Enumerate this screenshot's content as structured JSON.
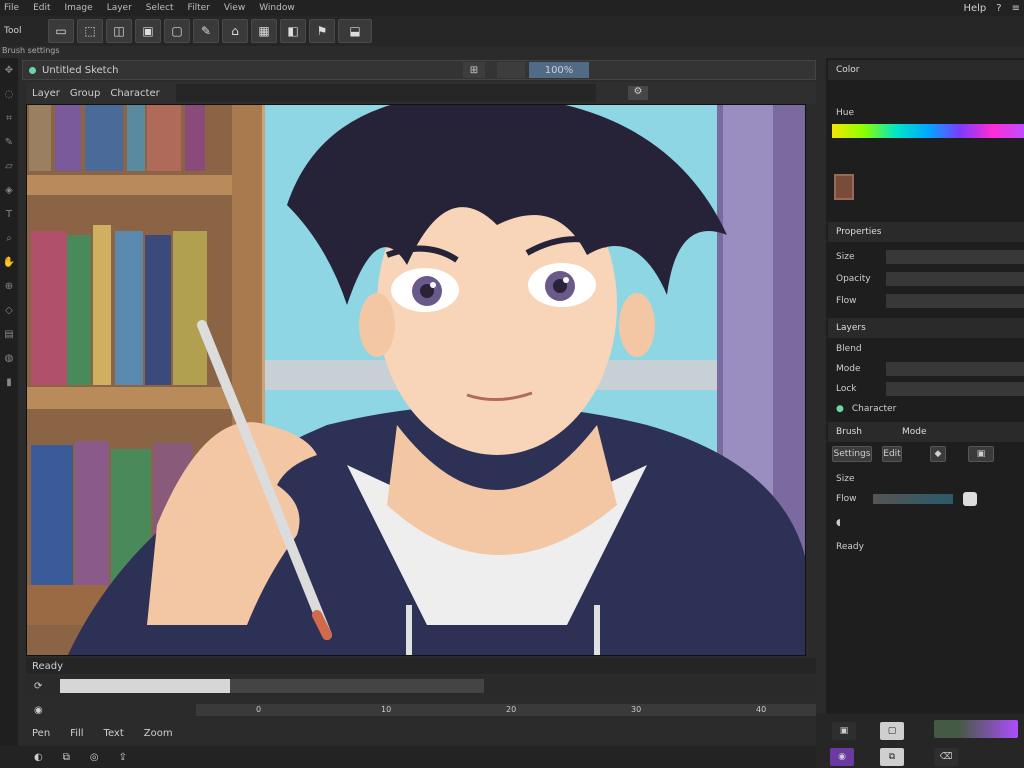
{
  "menubar": {
    "items": [
      "File",
      "Edit",
      "Image",
      "Layer",
      "Select",
      "Filter",
      "View",
      "Window"
    ],
    "right": [
      "Help",
      "?",
      "≡"
    ]
  },
  "toolbar": {
    "label": "Tool",
    "buttons": [
      "▭",
      "⬚",
      "◫",
      "▣",
      "▢",
      "✎",
      "⌂",
      "▦",
      "◧",
      "⚑",
      "⬓"
    ]
  },
  "subbar": {
    "text": "Brush settings"
  },
  "document": {
    "tab_title": "Untitled Sketch",
    "zoom": "100%",
    "breadcrumb": [
      "Layer",
      "Group",
      "Character"
    ]
  },
  "statusbar": {
    "label": "Ready",
    "progress": 0.4,
    "timeline_ticks": [
      "0",
      "10",
      "20",
      "30",
      "40"
    ]
  },
  "bottom_tools": [
    "Pen",
    "Fill",
    "Text",
    "Zoom"
  ],
  "right_panel": {
    "color_header": "Color",
    "color_sub": "Hue",
    "props_header": "Properties",
    "rows": [
      "Size",
      "Opacity",
      "Flow"
    ],
    "layers_header": "Layers",
    "layer_rows": [
      "Blend",
      "Mode",
      "Lock"
    ],
    "layer_name": "Character",
    "brush_header": "Brush",
    "brush_mode": "Mode",
    "brush_buttons": [
      "Settings",
      "Edit"
    ],
    "brush_rows": [
      "Size",
      "Flow"
    ],
    "info": "Ready"
  }
}
